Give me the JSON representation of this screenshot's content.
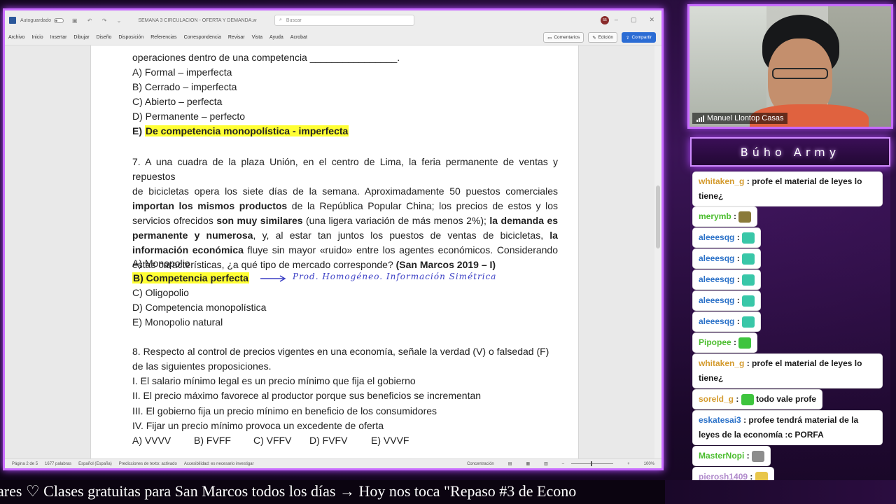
{
  "word": {
    "autosave_label": "Autoguardado",
    "doc_title": "SEMANA 3 CIRCULACION - OFERTA Y DEMANDA.w",
    "search_placeholder": "Buscar",
    "user_initials": "55",
    "menu": [
      "Archivo",
      "Inicio",
      "Insertar",
      "Dibujar",
      "Diseño",
      "Disposición",
      "Referencias",
      "Correspondencia",
      "Revisar",
      "Vista",
      "Ayuda",
      "Acrobat"
    ],
    "comments_label": "Comentarios",
    "editing_label": "Edición",
    "share_label": "Compartir"
  },
  "document": {
    "q6_tail": "operaciones dentro de una competencia ________________.",
    "q6_options": [
      "A) Formal – imperfecta",
      "B) Cerrado – imperfecta",
      "C) Abierto – perfecta",
      "D) Permanente – perfecto"
    ],
    "q6_answer_letter": "E)",
    "q6_answer": "De competencia monopolística - imperfecta",
    "q7_lines": [
      [
        {
          "t": "7. A una cuadra de la plaza Unión, en el centro de Lima, la feria permanente de ventas y repuestos"
        }
      ],
      [
        {
          "t": "de bicicletas opera los siete días de la semana. Aproximadamente 50 puestos comerciales"
        }
      ],
      [
        {
          "t": "importan los mismos productos",
          "b": true
        },
        {
          "t": " de la República Popular China; los precios de estos y los"
        }
      ],
      [
        {
          "t": "servicios ofrecidos "
        },
        {
          "t": "son muy similares",
          "b": true
        },
        {
          "t": " (una ligera variación de más menos 2%); "
        },
        {
          "t": "la demanda es",
          "b": true
        }
      ],
      [
        {
          "t": "permanente y numerosa",
          "b": true
        },
        {
          "t": ", y, al estar tan juntos los puestos de ventas de bicicletas, "
        },
        {
          "t": "la",
          "b": true
        }
      ],
      [
        {
          "t": "información económica",
          "b": true
        },
        {
          "t": " fluye sin mayor «ruido» entre los agentes económicos. Considerando"
        }
      ],
      [
        {
          "t": "estas características, ¿a qué tipo de mercado corresponde? "
        },
        {
          "t": "(San Marcos 2019 – I)",
          "b": true
        }
      ]
    ],
    "q7_option_a": "A) Monopolio",
    "q7_answer": "B) Competencia perfecta",
    "q7_options_rest": [
      "C) Oligopolio",
      "D) Competencia monopolística",
      "E) Monopolio natural"
    ],
    "handwritten_note": "Prod. Homogéneo. Información Simétrica",
    "q8_lines": [
      "8. Respecto al control de precios vigentes en una economía, señale la verdad (V) o falsedad (F)",
      "de las siguientes proposiciones."
    ],
    "q8_statements": [
      "I. El salario mínimo legal es un precio mínimo que fija el gobierno",
      "II. El precio máximo favorece al productor porque sus beneficios se incrementan",
      "III. El gobierno fija un precio mínimo en beneficio de los consumidores",
      "IV. Fijar un precio mínimo provoca un excedente de oferta"
    ],
    "q8_options": [
      "A) VVVV",
      "B) FVFF",
      "C) VFFV",
      "D) FVFV",
      "E) VVVF"
    ]
  },
  "status": {
    "page": "Página 2 de 5",
    "words": "1677 palabras",
    "language": "Español (España)",
    "predictions": "Predicciones de texto: activado",
    "accessibility": "Accesibilidad: es necesario investigar",
    "focus": "Concentración",
    "zoom": "100%"
  },
  "webcam": {
    "name": "Manuel Llontop Casas"
  },
  "chat": {
    "title": "Búho Army",
    "messages": [
      {
        "user": "whitaken_g",
        "text": "profe el material de leyes lo tiene¿",
        "color": "#d49b2e"
      },
      {
        "user": "merymb",
        "text": "",
        "emote": "#8a7a3a",
        "color": "#4bbd2e"
      },
      {
        "user": "aleeesqg",
        "text": "",
        "emote": "#39c7a8",
        "color": "#2c72c8"
      },
      {
        "user": "aleeesqg",
        "text": "",
        "emote": "#39c7a8",
        "color": "#2c72c8"
      },
      {
        "user": "aleeesqg",
        "text": "",
        "emote": "#39c7a8",
        "color": "#2c72c8"
      },
      {
        "user": "aleeesqg",
        "text": "",
        "emote": "#39c7a8",
        "color": "#2c72c8"
      },
      {
        "user": "aleeesqg",
        "text": "",
        "emote": "#39c7a8",
        "color": "#2c72c8"
      },
      {
        "user": "Pipopee",
        "text": "",
        "emote": "#3ec43e",
        "color": "#4bbd2e"
      },
      {
        "user": "whitaken_g",
        "text": "profe el material de leyes lo tiene¿",
        "color": "#d49b2e"
      },
      {
        "user": "soreld_g",
        "text": "todo vale profe",
        "emote": "#3ec43e",
        "color": "#d49b2e"
      },
      {
        "user": "eskatesai3",
        "text": "profee tendrá material de la leyes de la economía :c PORFA",
        "color": "#2c72c8"
      },
      {
        "user": "MasterNopi",
        "text": "",
        "emote": "#8d8d8d",
        "color": "#4bbd2e"
      },
      {
        "user": "pierosh1409",
        "text": "",
        "emote": "#e8c64a",
        "color": "#b08acb"
      }
    ]
  },
  "ticker": {
    "text": "ares  ♡    Clases gratuitas para San Marcos todos los días  →  Hoy nos toca \"Repaso #3 de Econo"
  }
}
